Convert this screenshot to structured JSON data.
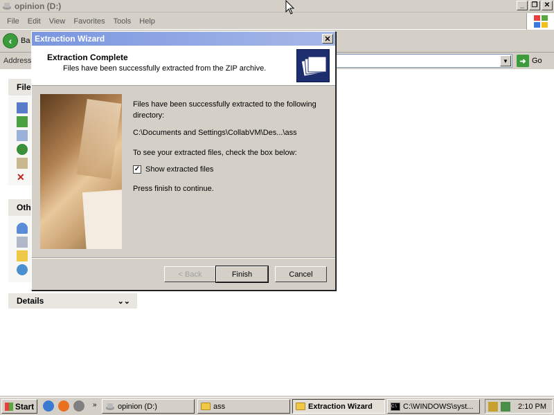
{
  "explorer": {
    "title": "opinion (D:)",
    "menu": [
      "File",
      "Edit",
      "View",
      "Favorites",
      "Tools",
      "Help"
    ],
    "back_label": "Ba",
    "address_label": "Address",
    "go_label": "Go",
    "file_tasks_header": "File",
    "other_places_header": "Oth",
    "details_header": "Details"
  },
  "dialog": {
    "title": "Extraction Wizard",
    "header_title": "Extraction Complete",
    "header_subtitle": "Files have been successfully extracted from the ZIP archive.",
    "body_line1": "Files have been successfully extracted to the following",
    "body_line2": "directory:",
    "path": "C:\\Documents and Settings\\CollabVM\\Des...\\ass",
    "check_prompt": "To see your extracted files, check the box below:",
    "checkbox_label": "Show extracted files",
    "checkbox_checked": true,
    "finish_prompt": "Press finish to continue.",
    "back_button": "< Back",
    "finish_button": "Finish",
    "cancel_button": "Cancel"
  },
  "taskbar": {
    "start_label": "Start",
    "buttons": [
      "opinion (D:)",
      "ass",
      "Extraction Wizard",
      "C:\\WINDOWS\\syst..."
    ],
    "active_index": 2,
    "time": "2:10 PM"
  }
}
